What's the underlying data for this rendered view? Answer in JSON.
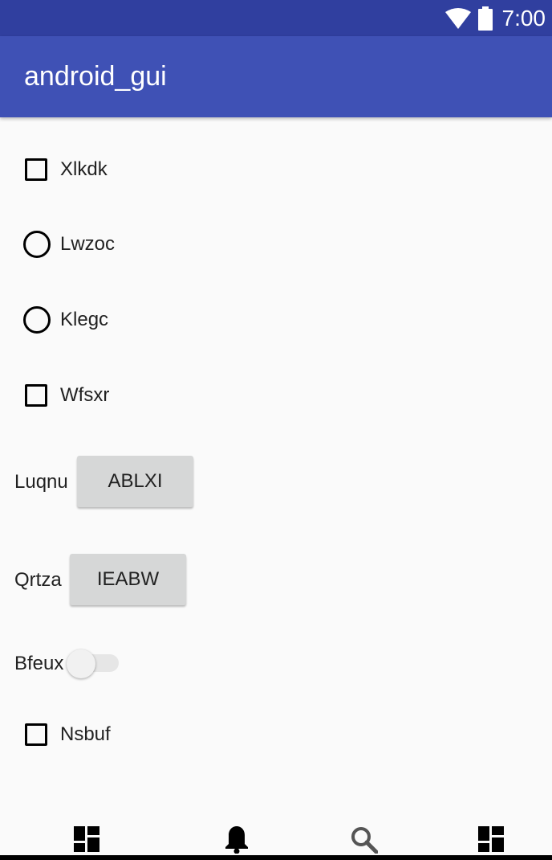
{
  "status_bar": {
    "time": "7:00",
    "icons": [
      "wifi-icon",
      "battery-icon"
    ]
  },
  "app_bar": {
    "title": "android_gui"
  },
  "controls": {
    "checkbox_1": {
      "label": "Xlkdk",
      "checked": false
    },
    "radio_1": {
      "label": "Lwzoc",
      "selected": false
    },
    "radio_2": {
      "label": "Klegc",
      "selected": false
    },
    "checkbox_2": {
      "label": "Wfsxr",
      "checked": false
    },
    "button_row_1": {
      "label": "Luqnu",
      "button": "ABLXI"
    },
    "button_row_2": {
      "label": "Qrtza",
      "button": "IEABW"
    },
    "switch_row": {
      "label": "Bfeux",
      "on": false
    },
    "checkbox_3": {
      "label": "Nsbuf",
      "checked": false
    }
  },
  "bottom_nav": {
    "items": [
      "dashboard-icon",
      "bell-icon",
      "search-icon",
      "dashboard-icon"
    ]
  },
  "colors": {
    "status_bar": "#303f9f",
    "app_bar": "#3f51b5",
    "background": "#fafafa",
    "button": "#d6d7d7"
  }
}
